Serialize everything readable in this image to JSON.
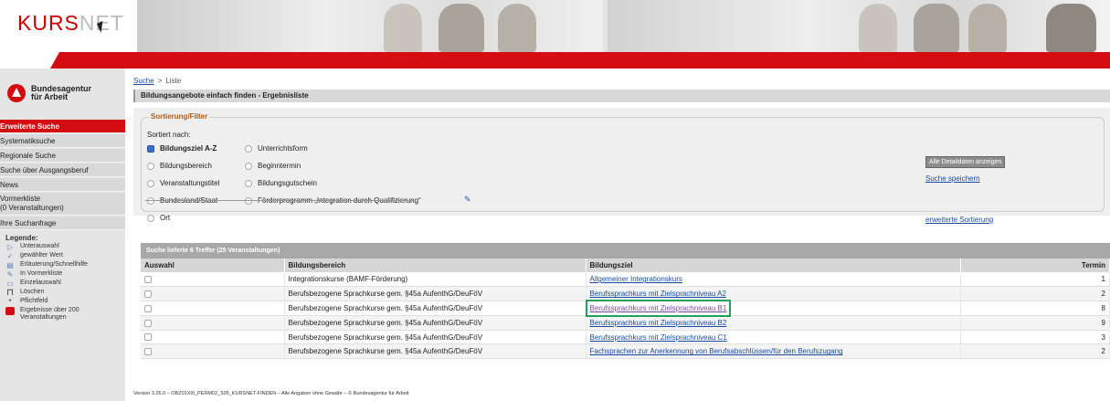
{
  "header": {
    "logo_kurs": "KURS",
    "logo_net": "NET"
  },
  "colors": {
    "brand_red": "#d40d12",
    "link_blue": "#1a4ba0",
    "legend_orange": "#b05a14",
    "highlight_green": "#22a35a"
  },
  "sidebar": {
    "org_name_line1": "Bundesagentur",
    "org_name_line2": "für Arbeit",
    "items": [
      {
        "label": "Erweiterte Suche",
        "active": true
      },
      {
        "label": "Systematiksuche"
      },
      {
        "label": "Regionale Suche"
      },
      {
        "label": "Suche über Ausgangsberuf"
      },
      {
        "label": "News"
      },
      {
        "label": "Vormerkliste",
        "sub": "(0 Veranstaltungen)"
      },
      {
        "label": "Ihre Suchanfrage"
      }
    ],
    "legend": {
      "title": "Legende:",
      "items": [
        {
          "icon": "arrow-icon",
          "label": "Unterauswahl"
        },
        {
          "icon": "checkmark-icon",
          "label": "gewählter Wert"
        },
        {
          "icon": "info-icon",
          "label": "Erläuterung/Schnellhilfe"
        },
        {
          "icon": "bookmark-icon",
          "label": "In Vormerkliste"
        },
        {
          "icon": "document-icon",
          "label": "Einzelauswahl"
        },
        {
          "icon": "trash-icon",
          "label": "Löschen"
        },
        {
          "icon": "required-icon",
          "label": "Pflichtfeld"
        },
        {
          "icon": "stack-icon",
          "label": "Ergebnisse über 200 Veranstaltungen"
        }
      ]
    }
  },
  "breadcrumb": {
    "link": "Suche",
    "separator": ">",
    "current": "Liste"
  },
  "page_title": "Bildungsangebote einfach finden - Ergebnisliste",
  "filter": {
    "legend": "Sortierung/Filter",
    "sort_label": "Sortiert nach:",
    "options": [
      {
        "label": "Bildungsziel A-Z",
        "selected": true
      },
      {
        "label": "Bildungsbereich"
      },
      {
        "label": "Veranstaltungstitel"
      },
      {
        "label": "Bundesland/Staat"
      },
      {
        "label": "Ort"
      },
      {
        "label": "Unterrichtsform"
      },
      {
        "label": "Beginntermin"
      },
      {
        "label": "Bildungsgutschein"
      },
      {
        "label": "Förderprogramm „Integration durch Qualifizierung“"
      }
    ],
    "btn_details": "Alle Detaildaten anzeigen",
    "link_save": "Suche speichern",
    "link_sort": "erweiterte Sortierung"
  },
  "results": {
    "title": "Suche lieferte 6 Treffer (25 Veranstaltungen)",
    "columns": [
      "Auswahl",
      "Bildungsbereich",
      "Bildungsziel",
      "Termin"
    ],
    "rows": [
      {
        "bereich": "Integrationskurse (BAMF-Förderung)",
        "ziel": "Allgemeiner Integrationskurs",
        "termin": "1"
      },
      {
        "bereich": "Berufsbezogene Sprachkurse gem. §45a AufenthG/DeuFöV",
        "ziel": "Berufssprachkurs mit Zielsprachniveau A2",
        "termin": "2"
      },
      {
        "bereich": "Berufsbezogene Sprachkurse gem. §45a AufenthG/DeuFöV",
        "ziel": "Berufssprachkurs mit Zielsprachniveau B1",
        "termin": "8",
        "highlighted": true
      },
      {
        "bereich": "Berufsbezogene Sprachkurse gem. §45a AufenthG/DeuFöV",
        "ziel": "Berufssprachkurs mit Zielsprachniveau B2",
        "termin": "9"
      },
      {
        "bereich": "Berufsbezogene Sprachkurse gem. §45a AufenthG/DeuFöV",
        "ziel": "Berufssprachkurs mit Zielsprachniveau C1",
        "termin": "3"
      },
      {
        "bereich": "Berufsbezogene Sprachkurse gem. §45a AufenthG/DeuFöV",
        "ziel": "Fachsprachen zur Anerkennung von Berufsabschlüssen/für den Berufszugang",
        "termin": "2"
      }
    ]
  },
  "footer": "Version 3.26.0 – OBZ01XI0_PERM02_S05_KURSNET-FINDEN – Alle Angaben ohne Gewähr – © Bundesagentur für Arbeit"
}
